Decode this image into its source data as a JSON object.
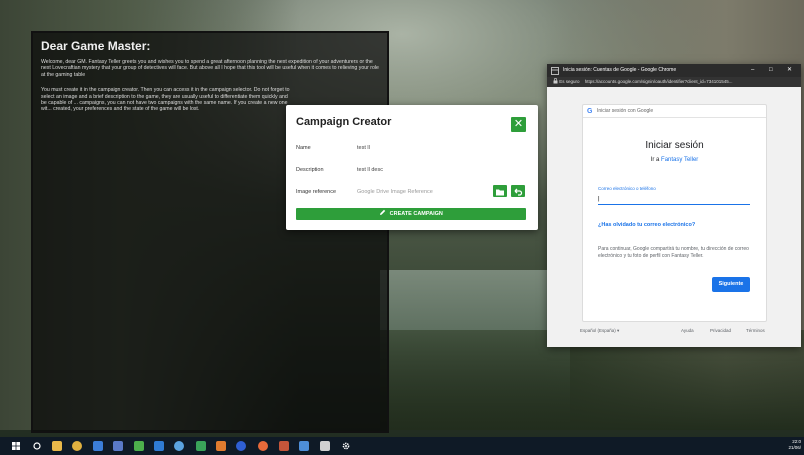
{
  "desktop": {
    "background": "painted-landscape"
  },
  "gm_panel": {
    "title": "Dear Game Master:",
    "paragraph1": "Welcome, dear GM. Fantasy Teller greets you and wishes you to spend a great afternoon planning the next expedition of your adventurers or the next Lovecraftian mystery that your group of detectives will face. But above all I hope that this tool will be useful when it comes to relieving your role at the gaming table",
    "paragraph2": "You must create it in the campaign creator. Then you can access it in the campaign selector. Do not forget to select an image and a brief description to the game, they are usually useful to differentiate them quickly and be capable of ... campaigns, you can not have two campaigns with the same name. If you create a new one wit... created, your preferences and the state of the game will be lost."
  },
  "campaign_creator": {
    "title": "Campaign Creator",
    "close_symbol": "✕",
    "name_label": "Name",
    "name_value": "test ll",
    "description_label": "Description",
    "description_value": "test ll desc",
    "image_label": "Image reference",
    "image_placeholder": "Google Drive Image Reference",
    "create_label": "CREATE CAMPAIGN",
    "accent_color": "#2e9e3a",
    "icons": [
      "folder-icon",
      "undo-icon",
      "pencil-icon",
      "close-icon"
    ]
  },
  "chrome": {
    "title": "Inicia sesión: Cuentas de Google - Google Chrome",
    "secure_label": "Es seguro",
    "url": "https://accounts.google.com/signin/oauth/identifier?client_id=734101545...",
    "minimize": "–",
    "maximize": "□",
    "close": "✕",
    "google": {
      "logo_letter": "G",
      "header": "Iniciar sesión con Google",
      "title": "Iniciar sesión",
      "subtitle_prefix": "Ir a",
      "subtitle_link": "Fantasy Teller",
      "input_label": "Correo electrónico o teléfono",
      "input_value": "|",
      "forgot": "¿Has olvidado tu correo electrónico?",
      "info": "Para continuar, Google compartirá tu nombre, tu dirección de correo electrónico y tu foto de perfil con Fantasy Teller.",
      "next": "Siguiente",
      "language": "Español (España) ▾",
      "help": "Ayuda",
      "privacy": "Privacidad",
      "terms": "Términos"
    }
  },
  "taskbar": {
    "time": "22:0",
    "date": "21/06/"
  }
}
